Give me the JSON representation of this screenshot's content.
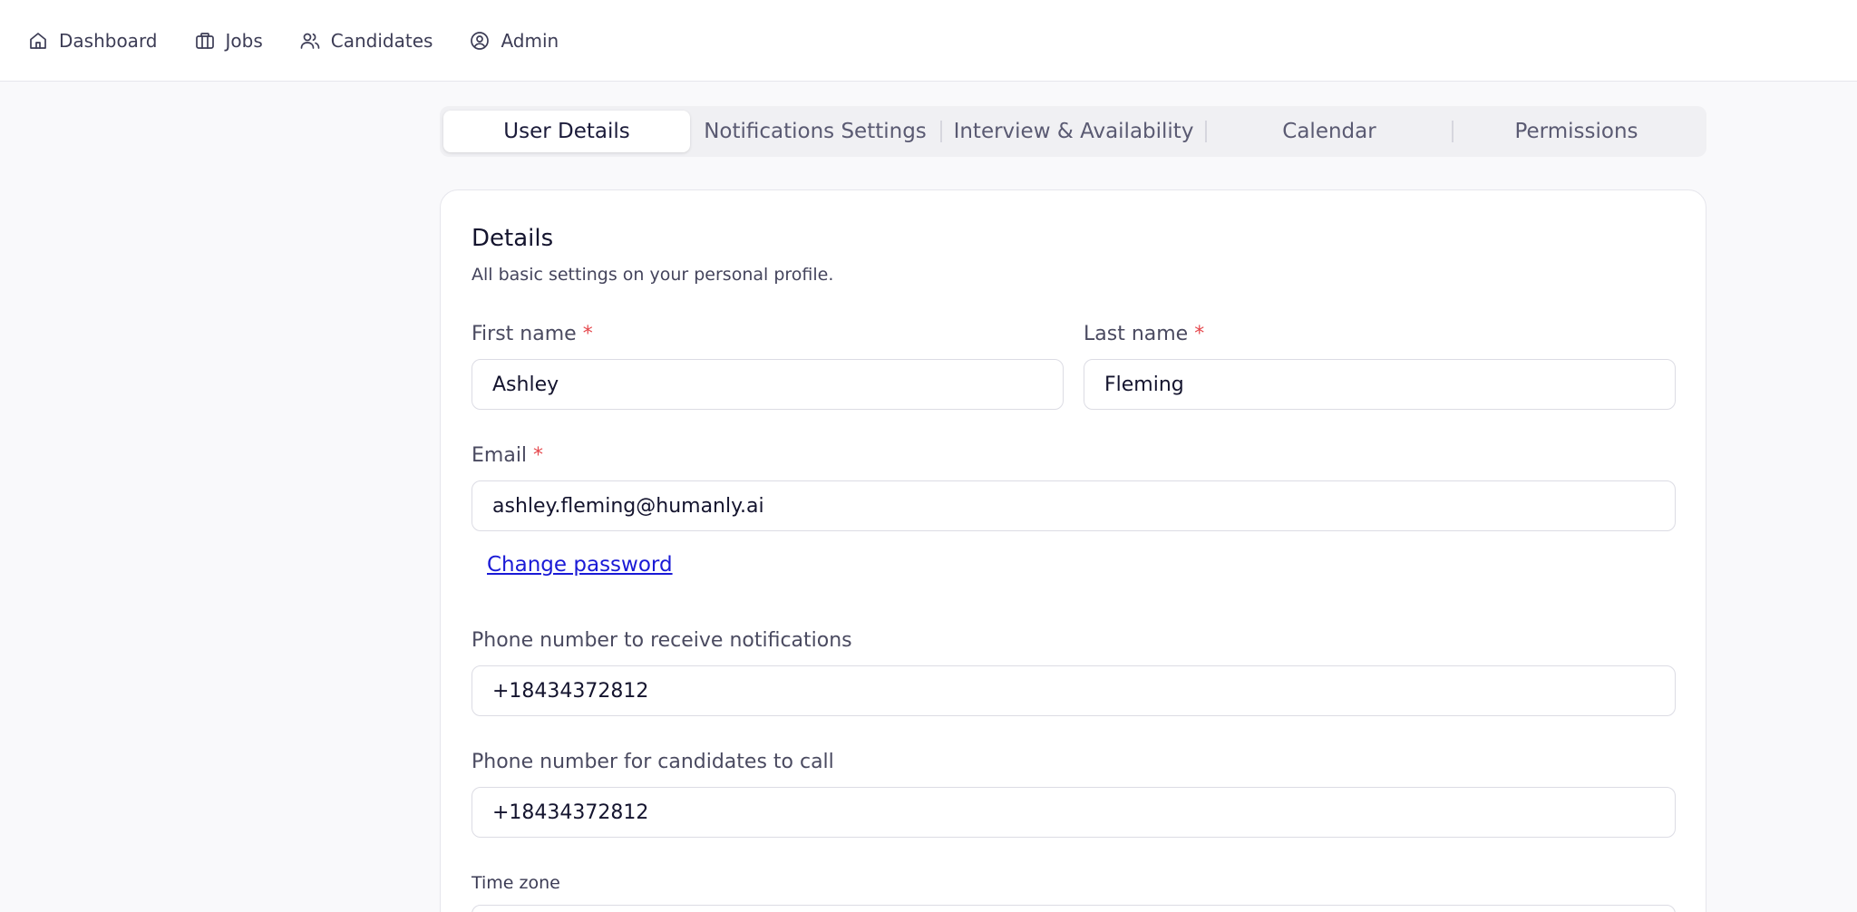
{
  "nav": {
    "items": [
      {
        "label": "Dashboard",
        "icon": "home-icon"
      },
      {
        "label": "Jobs",
        "icon": "briefcase-icon"
      },
      {
        "label": "Candidates",
        "icon": "users-icon"
      },
      {
        "label": "Admin",
        "icon": "user-circle-icon"
      }
    ]
  },
  "tabs": [
    {
      "label": "User Details",
      "active": true
    },
    {
      "label": "Notifications Settings",
      "active": false
    },
    {
      "label": "Interview & Availability",
      "active": false
    },
    {
      "label": "Calendar",
      "active": false
    },
    {
      "label": "Permissions",
      "active": false
    }
  ],
  "details": {
    "title": "Details",
    "subtitle": "All basic settings on your personal profile.",
    "first_name": {
      "label": "First name",
      "required_mark": "*",
      "value": "Ashley"
    },
    "last_name": {
      "label": "Last name",
      "required_mark": "*",
      "value": "Fleming"
    },
    "email": {
      "label": "Email",
      "required_mark": "*",
      "value": "ashley.fleming@humanly.ai"
    },
    "change_password": "Change password",
    "notify_phone": {
      "label": "Phone number to receive notifications",
      "value": "+18434372812"
    },
    "candidate_phone": {
      "label": "Phone number for candidates to call",
      "value": "+18434372812"
    },
    "time_zone": {
      "label": "Time zone"
    }
  },
  "colors": {
    "background": "#f9f9fb",
    "required": "#e5484d",
    "link": "#1a1ad6",
    "text": "#1b1b3a"
  }
}
